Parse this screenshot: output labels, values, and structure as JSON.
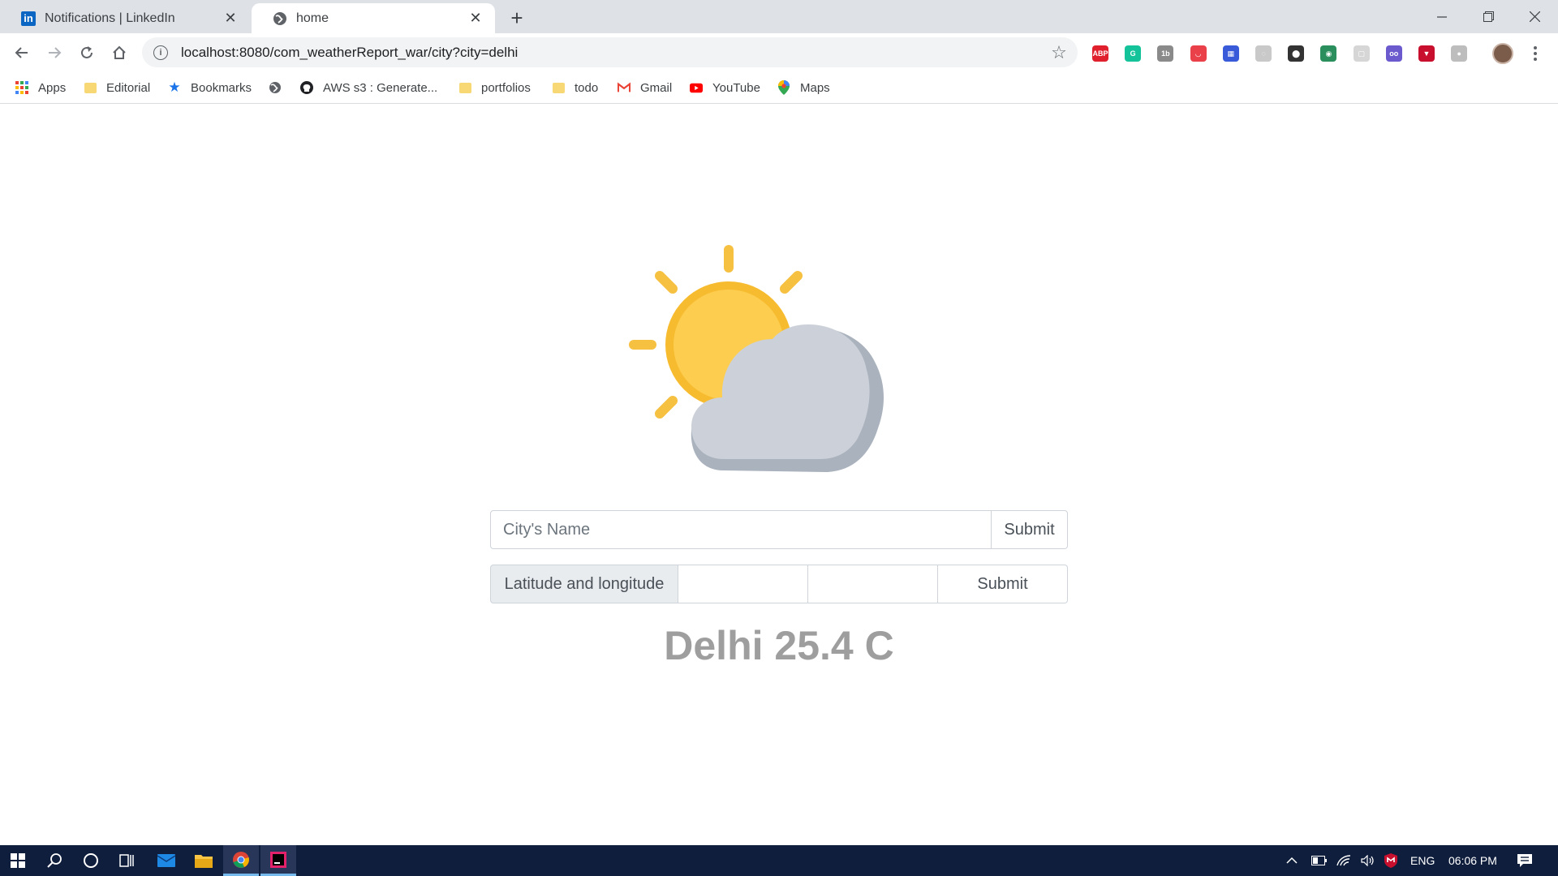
{
  "browser": {
    "tabs": [
      {
        "title": "Notifications | LinkedIn",
        "active": false,
        "favicon": "linkedin-icon"
      },
      {
        "title": "home",
        "active": true,
        "favicon": "globe-icon"
      }
    ],
    "close_glyph": "✕",
    "new_tab_glyph": "+",
    "url": "localhost:8080/com_weatherReport_war/city?city=delhi",
    "bookmarks": [
      {
        "label": "Apps",
        "icon": "apps-grid-icon"
      },
      {
        "label": "Editorial",
        "icon": "folder-icon"
      },
      {
        "label": "Bookmarks",
        "icon": "star-icon"
      },
      {
        "label": "",
        "icon": "globe-icon"
      },
      {
        "label": "AWS s3 : Generate...",
        "icon": "github-icon"
      },
      {
        "label": "portfolios",
        "icon": "folder-icon"
      },
      {
        "label": "todo",
        "icon": "folder-icon"
      },
      {
        "label": "Gmail",
        "icon": "gmail-icon"
      },
      {
        "label": "YouTube",
        "icon": "youtube-icon"
      },
      {
        "label": "Maps",
        "icon": "maps-icon"
      }
    ],
    "extensions": [
      {
        "name": "adblock-icon",
        "label": "ABP",
        "color": "#e0202c"
      },
      {
        "name": "grammarly-icon",
        "label": "G",
        "color": "#15c39a"
      },
      {
        "name": "extension-1b-icon",
        "label": "1b",
        "color": "#8a8a8a"
      },
      {
        "name": "pocket-icon",
        "label": "◡",
        "color": "#e9404a"
      },
      {
        "name": "extension-grid-icon",
        "label": "▦",
        "color": "#3a5bd9"
      },
      {
        "name": "extension-circle-icon",
        "label": "◌",
        "color": "#c9c9c9"
      },
      {
        "name": "location-pin-ext-icon",
        "label": "⬤",
        "color": "#333333"
      },
      {
        "name": "earth-ext-icon",
        "label": "◉",
        "color": "#2a8f5c"
      },
      {
        "name": "extension-faded-icon",
        "label": "▢",
        "color": "#d6d6d6"
      },
      {
        "name": "owl-ext-icon",
        "label": "oo",
        "color": "#6a5acd"
      },
      {
        "name": "shield-ext-icon",
        "label": "▼",
        "color": "#c8102e"
      },
      {
        "name": "extension-gray-icon",
        "label": "●",
        "color": "#bdbdbd"
      }
    ]
  },
  "page": {
    "city_form": {
      "placeholder": "City's Name",
      "value": "",
      "submit_label": "Submit"
    },
    "latlon_form": {
      "label": "Latitude and longitude",
      "lat_value": "",
      "lon_value": "",
      "submit_label": "Submit"
    },
    "result_text": "Delhi 25.4 C"
  },
  "taskbar": {
    "apps": [
      "windows-start-icon",
      "search-icon",
      "cortana-icon",
      "task-view-icon",
      "mail-icon",
      "file-explorer-icon",
      "chrome-icon",
      "intellij-icon"
    ],
    "language": "ENG",
    "time": "06:06 PM"
  },
  "colors": {
    "sun": "#fcc932",
    "sun_ray": "#f6c040",
    "cloud": "#ccd0d8",
    "cloud_shadow": "#aab2bd",
    "result_text": "#9e9e9e",
    "taskbar": "#0f1e3d"
  }
}
